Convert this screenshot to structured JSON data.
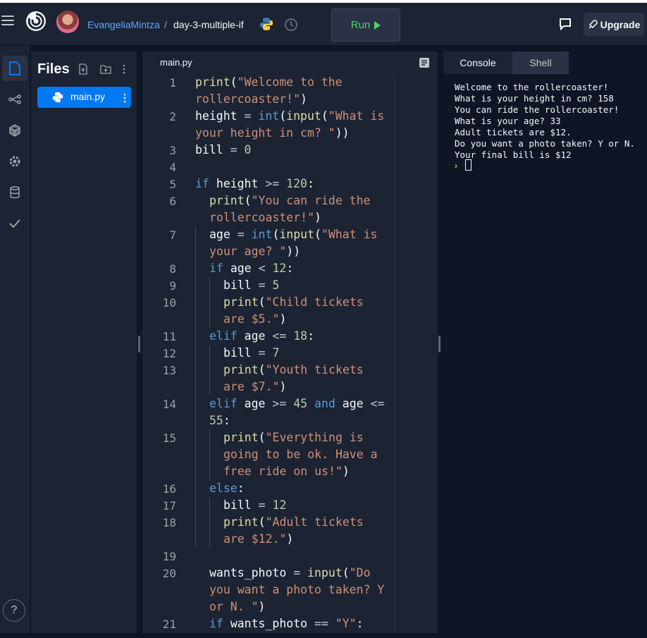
{
  "header": {
    "username": "EvangeliaMintza",
    "separator": "/",
    "repl_name": "day-3-multiple-if",
    "run_label": "Run",
    "upgrade_label": "Upgrade"
  },
  "files": {
    "title": "Files",
    "items": [
      {
        "label": "main.py"
      }
    ]
  },
  "editor": {
    "tab_label": "main.py",
    "lines": [
      {
        "n": "1",
        "segs": [
          [
            "fn",
            "print"
          ],
          [
            "p",
            "("
          ],
          [
            "s",
            "\"Welcome to the"
          ]
        ]
      },
      {
        "n": "",
        "segs": [
          [
            "s",
            "rollercoaster!\""
          ],
          [
            "p",
            ")"
          ]
        ]
      },
      {
        "n": "2",
        "segs": [
          [
            "v",
            "height "
          ],
          [
            "o",
            "= "
          ],
          [
            "kw",
            "int"
          ],
          [
            "p",
            "("
          ],
          [
            "fn",
            "input"
          ],
          [
            "p",
            "("
          ],
          [
            "s",
            "\"What is"
          ]
        ]
      },
      {
        "n": "",
        "segs": [
          [
            "s",
            "your height in cm? \""
          ],
          [
            "p",
            "))"
          ]
        ]
      },
      {
        "n": "3",
        "segs": [
          [
            "v",
            "bill "
          ],
          [
            "o",
            "= "
          ],
          [
            "num",
            "0"
          ]
        ]
      },
      {
        "n": "4",
        "segs": []
      },
      {
        "n": "5",
        "segs": [
          [
            "kw",
            "if "
          ],
          [
            "v",
            "height "
          ],
          [
            "o",
            ">= "
          ],
          [
            "num",
            "120"
          ],
          [
            "p",
            ":"
          ]
        ]
      },
      {
        "n": "6",
        "segs": [
          [
            "fn",
            "print"
          ],
          [
            "p",
            "("
          ],
          [
            "s",
            "\"You can ride the"
          ]
        ]
      },
      {
        "n": "",
        "segs": [
          [
            "s",
            "rollercoaster!\""
          ],
          [
            "p",
            ")"
          ]
        ]
      },
      {
        "n": "7",
        "segs": [
          [
            "v",
            "age "
          ],
          [
            "o",
            "= "
          ],
          [
            "kw",
            "int"
          ],
          [
            "p",
            "("
          ],
          [
            "fn",
            "input"
          ],
          [
            "p",
            "("
          ],
          [
            "s",
            "\"What is"
          ]
        ]
      },
      {
        "n": "",
        "segs": [
          [
            "s",
            "your age? \""
          ],
          [
            "p",
            "))"
          ]
        ]
      },
      {
        "n": "8",
        "segs": [
          [
            "kw",
            "if "
          ],
          [
            "v",
            "age "
          ],
          [
            "o",
            "< "
          ],
          [
            "num",
            "12"
          ],
          [
            "p",
            ":"
          ]
        ]
      },
      {
        "n": "9",
        "segs": [
          [
            "v",
            "bill "
          ],
          [
            "o",
            "= "
          ],
          [
            "num",
            "5"
          ]
        ]
      },
      {
        "n": "10",
        "segs": [
          [
            "fn",
            "print"
          ],
          [
            "p",
            "("
          ],
          [
            "s",
            "\"Child tickets"
          ]
        ]
      },
      {
        "n": "",
        "segs": [
          [
            "s",
            "are $5.\""
          ],
          [
            "p",
            ")"
          ]
        ]
      },
      {
        "n": "11",
        "segs": [
          [
            "kw",
            "elif "
          ],
          [
            "v",
            "age "
          ],
          [
            "o",
            "<= "
          ],
          [
            "num",
            "18"
          ],
          [
            "p",
            ":"
          ]
        ]
      },
      {
        "n": "12",
        "segs": [
          [
            "v",
            "bill "
          ],
          [
            "o",
            "= "
          ],
          [
            "num",
            "7"
          ]
        ]
      },
      {
        "n": "13",
        "segs": [
          [
            "fn",
            "print"
          ],
          [
            "p",
            "("
          ],
          [
            "s",
            "\"Youth tickets"
          ]
        ]
      },
      {
        "n": "",
        "segs": [
          [
            "s",
            "are $7.\""
          ],
          [
            "p",
            ")"
          ]
        ]
      },
      {
        "n": "14",
        "segs": [
          [
            "kw",
            "elif "
          ],
          [
            "v",
            "age "
          ],
          [
            "o",
            ">= "
          ],
          [
            "num",
            "45 "
          ],
          [
            "kw",
            "and "
          ],
          [
            "v",
            "age "
          ],
          [
            "o",
            "<="
          ]
        ]
      },
      {
        "n": "",
        "segs": [
          [
            "num",
            "55"
          ],
          [
            "p",
            ":"
          ]
        ]
      },
      {
        "n": "15",
        "segs": [
          [
            "fn",
            "print"
          ],
          [
            "p",
            "("
          ],
          [
            "s",
            "\"Everything is"
          ]
        ]
      },
      {
        "n": "",
        "segs": [
          [
            "s",
            "going to be ok. Have a"
          ]
        ]
      },
      {
        "n": "",
        "segs": [
          [
            "s",
            "free ride on us!\""
          ],
          [
            "p",
            ")"
          ]
        ]
      },
      {
        "n": "16",
        "segs": [
          [
            "kw",
            "else"
          ],
          [
            "p",
            ":"
          ]
        ]
      },
      {
        "n": "17",
        "segs": [
          [
            "v",
            "bill "
          ],
          [
            "o",
            "= "
          ],
          [
            "num",
            "12"
          ]
        ]
      },
      {
        "n": "18",
        "segs": [
          [
            "fn",
            "print"
          ],
          [
            "p",
            "("
          ],
          [
            "s",
            "\"Adult tickets"
          ]
        ]
      },
      {
        "n": "",
        "segs": [
          [
            "s",
            "are $12.\""
          ],
          [
            "p",
            ")"
          ]
        ]
      },
      {
        "n": "19",
        "segs": []
      },
      {
        "n": "20",
        "segs": [
          [
            "v",
            "wants_photo "
          ],
          [
            "o",
            "= "
          ],
          [
            "fn",
            "input"
          ],
          [
            "p",
            "("
          ],
          [
            "s",
            "\"Do"
          ]
        ]
      },
      {
        "n": "",
        "segs": [
          [
            "s",
            "you want a photo taken? Y"
          ]
        ]
      },
      {
        "n": "",
        "segs": [
          [
            "s",
            "or N. \""
          ],
          [
            "p",
            ")"
          ]
        ]
      },
      {
        "n": "21",
        "segs": [
          [
            "kw",
            "if "
          ],
          [
            "v",
            "wants_photo "
          ],
          [
            "o",
            "== "
          ],
          [
            "s",
            "\"Y\""
          ],
          [
            "p",
            ":"
          ]
        ]
      }
    ]
  },
  "console": {
    "tabs": [
      "Console",
      "Shell"
    ],
    "lines": [
      "Welcome to the rollercoaster!",
      "What is your height in cm? 158",
      "You can ride the rollercoaster!",
      "What is your age? 33",
      "Adult tickets are $12.",
      "Do you want a photo taken? Y or N.",
      "Your final bill is $12"
    ],
    "prompt": "›"
  },
  "help_label": "?",
  "colors": {
    "bg": "#0e1525",
    "panel": "#1c2333",
    "accent": "#0079f2",
    "run_green": "#4fd36b",
    "keyword": "#569cd6",
    "string": "#ce9178",
    "number": "#b5cea8",
    "function": "#dcdcaa",
    "operator": "#c2c8cc"
  }
}
